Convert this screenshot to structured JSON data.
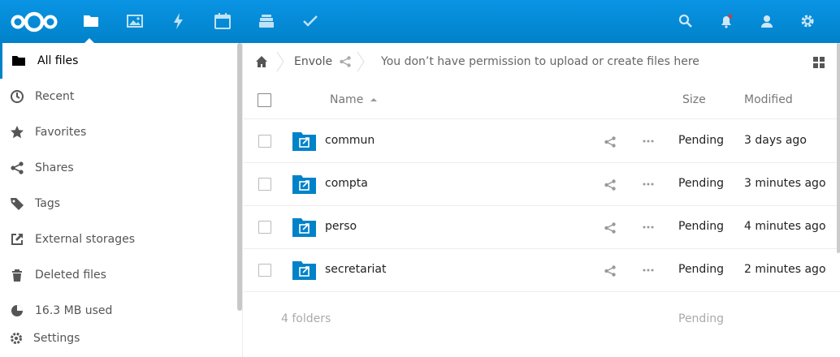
{
  "header": {
    "apps": [
      {
        "name": "files",
        "active": true
      },
      {
        "name": "photos"
      },
      {
        "name": "activity"
      },
      {
        "name": "calendar"
      },
      {
        "name": "deck"
      },
      {
        "name": "tasks"
      }
    ],
    "right_icons": [
      "search-icon",
      "notifications-icon",
      "contacts-icon",
      "settings-icon"
    ],
    "accent": "#0082c9"
  },
  "sidebar": {
    "items": [
      {
        "label": "All files",
        "icon": "folder-icon",
        "active": true
      },
      {
        "label": "Recent",
        "icon": "clock-icon"
      },
      {
        "label": "Favorites",
        "icon": "star-icon"
      },
      {
        "label": "Shares",
        "icon": "share-icon"
      },
      {
        "label": "Tags",
        "icon": "tag-icon"
      },
      {
        "label": "External storages",
        "icon": "external-icon"
      },
      {
        "label": "Deleted files",
        "icon": "trash-icon"
      }
    ],
    "quota": "16.3 MB used",
    "settings": "Settings"
  },
  "breadcrumb": {
    "folder": "Envole",
    "message": "You don’t have permission to upload or create files here"
  },
  "table": {
    "headers": {
      "name": "Name",
      "size": "Size",
      "modified": "Modified"
    },
    "rows": [
      {
        "name": "commun",
        "size": "Pending",
        "modified": "3 days ago"
      },
      {
        "name": "compta",
        "size": "Pending",
        "modified": "3 minutes ago"
      },
      {
        "name": "perso",
        "size": "Pending",
        "modified": "4 minutes ago"
      },
      {
        "name": "secretariat",
        "size": "Pending",
        "modified": "2 minutes ago"
      }
    ],
    "summary": {
      "count": "4 folders",
      "size": "Pending"
    }
  }
}
